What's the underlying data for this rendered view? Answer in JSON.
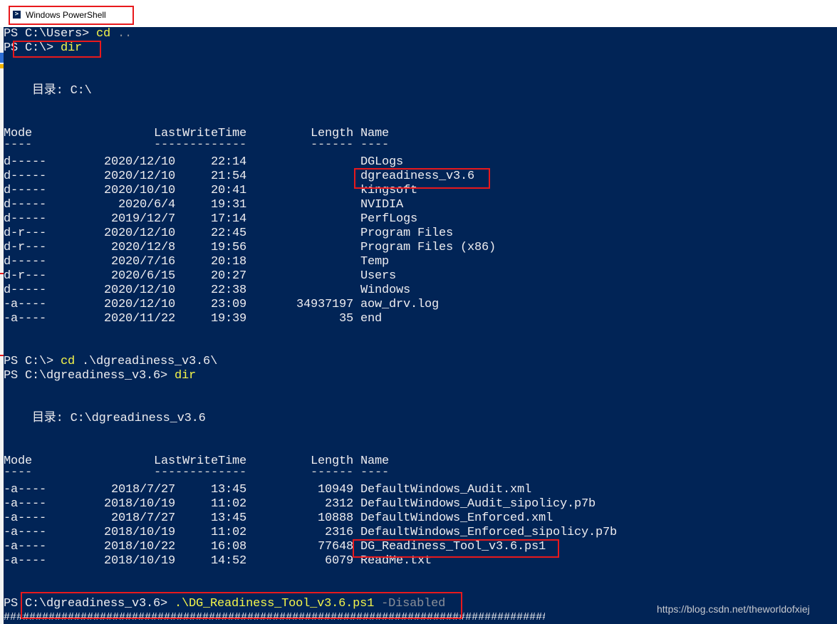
{
  "window": {
    "title": "Windows PowerShell",
    "icon": "powershell-icon"
  },
  "colors": {
    "console_bg": "#012456",
    "console_fg": "#eeedf0",
    "command": "#f5f54a",
    "parameter": "#8a8f98",
    "annotation": "#e8191c"
  },
  "session": {
    "line1": {
      "prompt": "PS C:\\Users> ",
      "command": "cd",
      "argument": " .."
    },
    "line2": {
      "prompt": "PS C:\\> ",
      "command": "dir"
    },
    "dir1_label": "    目录: C:\\",
    "headers": {
      "mode": "Mode",
      "lastwritetime": "LastWriteTime",
      "length": "Length",
      "name": "Name"
    },
    "underlines": {
      "mode": "----",
      "lastwritetime": "-------------",
      "length": "------",
      "name": "----"
    },
    "listing1": [
      {
        "mode": "d-----",
        "date": "2020/12/10",
        "time": "22:14",
        "length": "",
        "name": "DGLogs"
      },
      {
        "mode": "d-----",
        "date": "2020/12/10",
        "time": "21:54",
        "length": "",
        "name": "dgreadiness_v3.6"
      },
      {
        "mode": "d-----",
        "date": "2020/10/10",
        "time": "20:41",
        "length": "",
        "name": "kingsoft"
      },
      {
        "mode": "d-----",
        "date": "2020/6/4",
        "time": "19:31",
        "length": "",
        "name": "NVIDIA"
      },
      {
        "mode": "d-----",
        "date": "2019/12/7",
        "time": "17:14",
        "length": "",
        "name": "PerfLogs"
      },
      {
        "mode": "d-r---",
        "date": "2020/12/10",
        "time": "22:45",
        "length": "",
        "name": "Program Files"
      },
      {
        "mode": "d-r---",
        "date": "2020/12/8",
        "time": "19:56",
        "length": "",
        "name": "Program Files (x86)"
      },
      {
        "mode": "d-----",
        "date": "2020/7/16",
        "time": "20:18",
        "length": "",
        "name": "Temp"
      },
      {
        "mode": "d-r---",
        "date": "2020/6/15",
        "time": "20:27",
        "length": "",
        "name": "Users"
      },
      {
        "mode": "d-----",
        "date": "2020/12/10",
        "time": "22:38",
        "length": "",
        "name": "Windows"
      },
      {
        "mode": "-a----",
        "date": "2020/12/10",
        "time": "23:09",
        "length": "34937197",
        "name": "aow_drv.log"
      },
      {
        "mode": "-a----",
        "date": "2020/11/22",
        "time": "19:39",
        "length": "35",
        "name": "end"
      }
    ],
    "line3": {
      "prompt": "PS C:\\> ",
      "command": "cd",
      "argument": " .\\dgreadiness_v3.6\\"
    },
    "line4": {
      "prompt": "PS C:\\dgreadiness_v3.6> ",
      "command": "dir"
    },
    "dir2_label": "    目录: C:\\dgreadiness_v3.6",
    "listing2": [
      {
        "mode": "-a----",
        "date": "2018/7/27",
        "time": "13:45",
        "length": "10949",
        "name": "DefaultWindows_Audit.xml"
      },
      {
        "mode": "-a----",
        "date": "2018/10/19",
        "time": "11:02",
        "length": "2312",
        "name": "DefaultWindows_Audit_sipolicy.p7b"
      },
      {
        "mode": "-a----",
        "date": "2018/7/27",
        "time": "13:45",
        "length": "10888",
        "name": "DefaultWindows_Enforced.xml"
      },
      {
        "mode": "-a----",
        "date": "2018/10/19",
        "time": "11:02",
        "length": "2316",
        "name": "DefaultWindows_Enforced_sipolicy.p7b"
      },
      {
        "mode": "-a----",
        "date": "2018/10/22",
        "time": "16:08",
        "length": "77648",
        "name": "DG_Readiness_Tool_v3.6.ps1"
      },
      {
        "mode": "-a----",
        "date": "2018/10/19",
        "time": "14:52",
        "length": "6079",
        "name": "ReadMe.txt"
      }
    ],
    "line5": {
      "prompt": "PS C:\\dgreadiness_v3.6> ",
      "command": ".\\DG_Readiness_Tool_v3.6.ps1",
      "argument": " -Disabled"
    },
    "hash_line": "##########################################################################################"
  },
  "watermark": "https://blog.csdn.net/theworldofxiej"
}
